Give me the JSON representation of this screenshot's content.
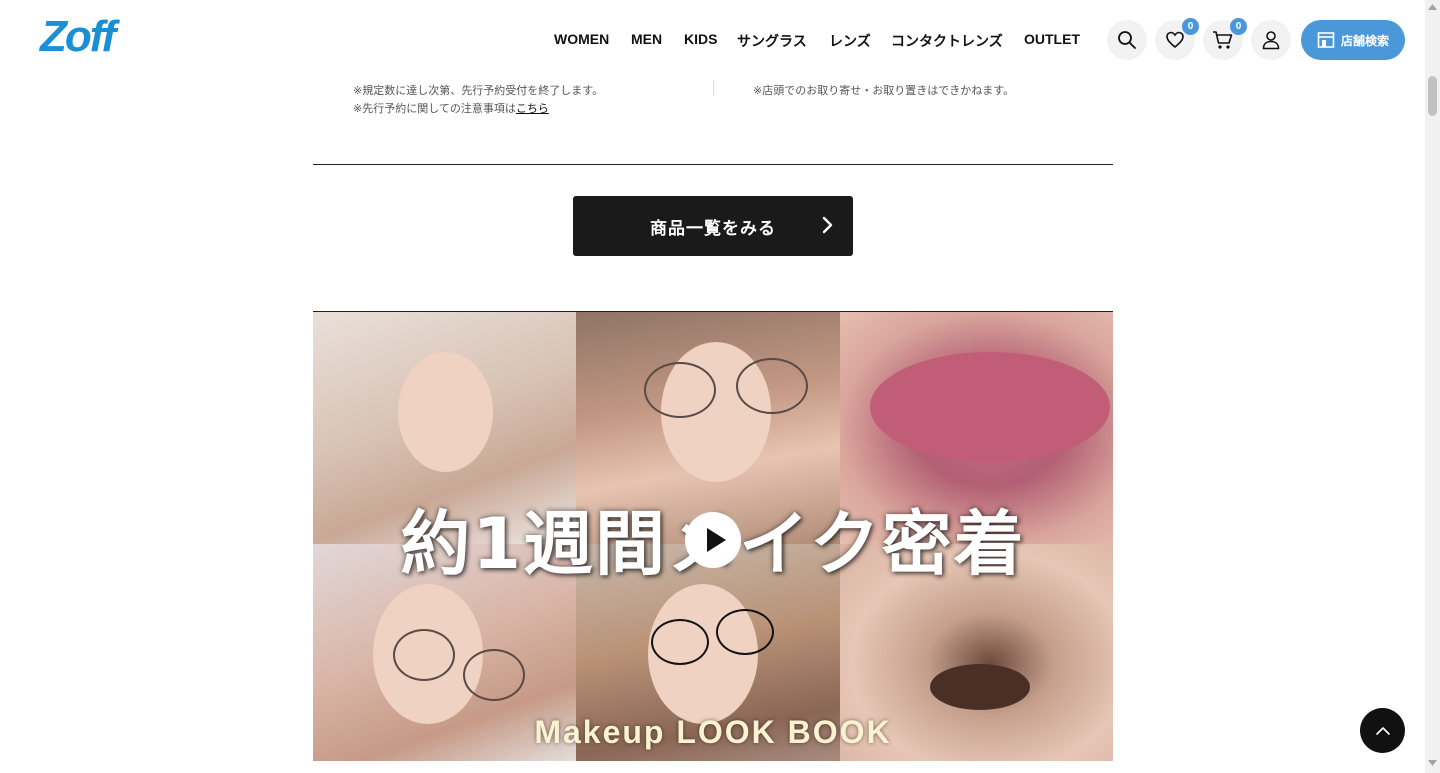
{
  "brand": {
    "logo_text": "Zoff",
    "logo_color": "#1b8fd6",
    "accent": "#4a98d9"
  },
  "nav": {
    "items": [
      {
        "label": "WOMEN"
      },
      {
        "label": "MEN"
      },
      {
        "label": "KIDS"
      },
      {
        "label": "サングラス"
      },
      {
        "label": "レンズ"
      },
      {
        "label": "コンタクトレンズ"
      },
      {
        "label": "OUTLET"
      }
    ]
  },
  "header_actions": {
    "search_icon": "search-icon",
    "favorites_count": "0",
    "cart_count": "0",
    "account_icon": "user-icon",
    "store_search_label": "店舗検索"
  },
  "notes": {
    "left_line1": "※規定数に達し次第、先行予約受付を終了します。",
    "left_line2_prefix": "※先行予約に関しての注意事項は",
    "left_line2_link": "こちら",
    "right_line1": "※店頭でのお取り寄せ・お取り置きはできかねます。"
  },
  "cta": {
    "label": "商品一覧をみる"
  },
  "video": {
    "title": "約1週間メイク密着",
    "subtitle": "Makeup LOOK BOOK",
    "play_icon": "play-icon"
  }
}
